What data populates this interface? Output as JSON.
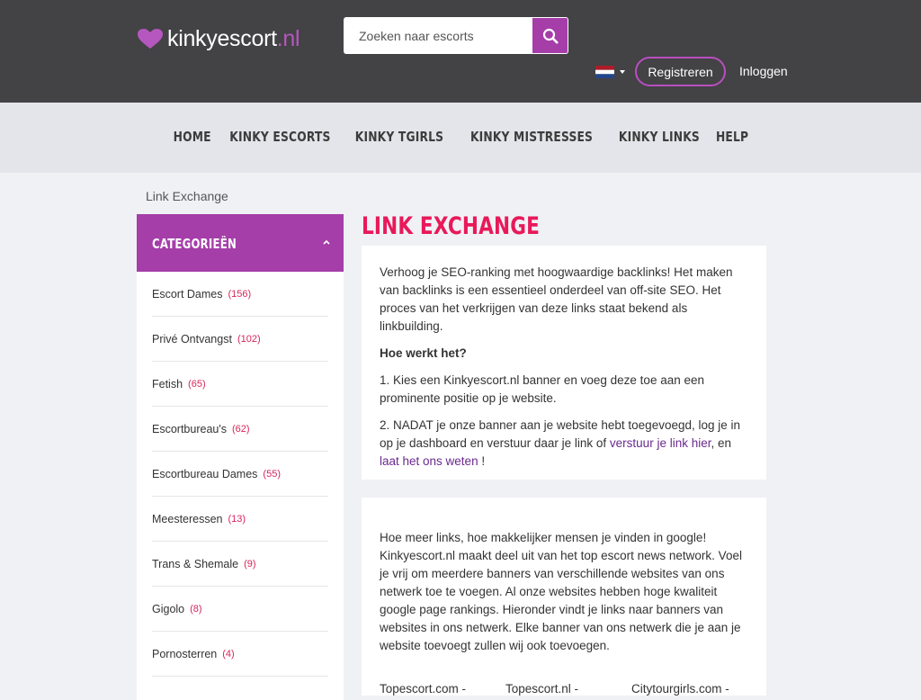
{
  "header": {
    "logo_text": "kinkyescort",
    "logo_tld": ".nl",
    "search_placeholder": "Zoeken naar escorts",
    "register_label": "Registreren",
    "login_label": "Inloggen",
    "language_flag": "netherlands-flag"
  },
  "nav": {
    "items": [
      "HOME",
      "KINKY ESCORTS",
      "KINKY TGIRLS",
      "KINKY MISTRESSES",
      "KINKY LINKS",
      "HELP"
    ]
  },
  "breadcrumb": "Link Exchange",
  "sidebar": {
    "title": "CATEGORIEËN",
    "categories": [
      {
        "label": "Escort Dames",
        "count": "(156)"
      },
      {
        "label": "Privé Ontvangst",
        "count": "(102)"
      },
      {
        "label": "Fetish",
        "count": "(65)"
      },
      {
        "label": "Escortbureau's",
        "count": "(62)"
      },
      {
        "label": "Escortbureau Dames",
        "count": "(55)"
      },
      {
        "label": "Meesteressen",
        "count": "(13)"
      },
      {
        "label": "Trans & Shemale",
        "count": "(9)"
      },
      {
        "label": "Gigolo",
        "count": "(8)"
      },
      {
        "label": "Pornosterren",
        "count": "(4)"
      }
    ]
  },
  "main": {
    "title": "LINK EXCHANGE",
    "intro": "Verhoog je SEO-ranking met hoogwaardige backlinks! Het maken van backlinks is een essentieel onderdeel van off-site SEO. Het proces van het verkrijgen van deze links staat bekend als linkbuilding.",
    "how_heading": "Hoe werkt het?",
    "step1": "1. Kies een Kinkyescort.nl banner en voeg deze toe aan een prominente positie op je website.",
    "step2_prefix": "2. NADAT je onze banner aan je website hebt toegevoegd, log je in op je dashboard en verstuur daar je link of ",
    "step2_link1": "verstuur je link hier",
    "step2_middle": ", en ",
    "step2_link2": "laat het ons weten",
    "step2_suffix": " !",
    "network_text": "Hoe meer links, hoe makkelijker mensen je vinden in google! Kinkyescort.nl maakt deel uit van het top escort news network. Voel je vrij om meerdere banners van verschillende websites van ons netwerk toe te voegen. Al onze websites hebben hoge kwaliteit google page rankings. Hieronder vindt je links naar banners van websites in ons netwerk. Elke banner van ons netwerk die je aan je website toevoegt zullen wij ook toevoegen.",
    "banners": [
      "Topescort.com -",
      "Topescort.nl -",
      "Citytourgirls.com -"
    ]
  },
  "colors": {
    "header_bg": "#434245",
    "accent_purple": "#a53ea9",
    "title_pink": "#e8195a",
    "count_red": "#d8245b"
  }
}
